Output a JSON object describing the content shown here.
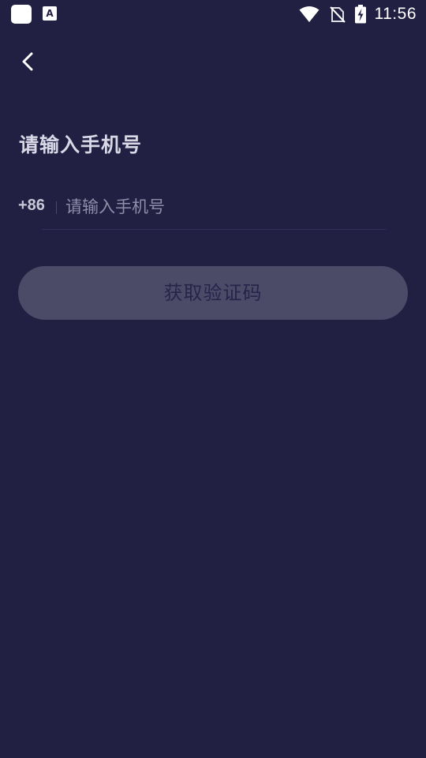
{
  "status_bar": {
    "time": "11:56",
    "notification_letter": "A",
    "icons": [
      "app-notification-icon",
      "a-notification-icon",
      "wifi-icon",
      "no-sim-icon",
      "battery-charging-icon"
    ]
  },
  "header": {
    "back_icon": "chevron-left-icon"
  },
  "main": {
    "title": "请输入手机号",
    "country_code": "+86",
    "phone_placeholder": "请输入手机号",
    "phone_value": "",
    "get_code_label": "获取验证码"
  },
  "colors": {
    "background": "#222042",
    "button_bg": "#4b4a67",
    "button_text": "#26244a",
    "title_text": "#d9d8e6",
    "placeholder_text": "#8f8da8"
  }
}
